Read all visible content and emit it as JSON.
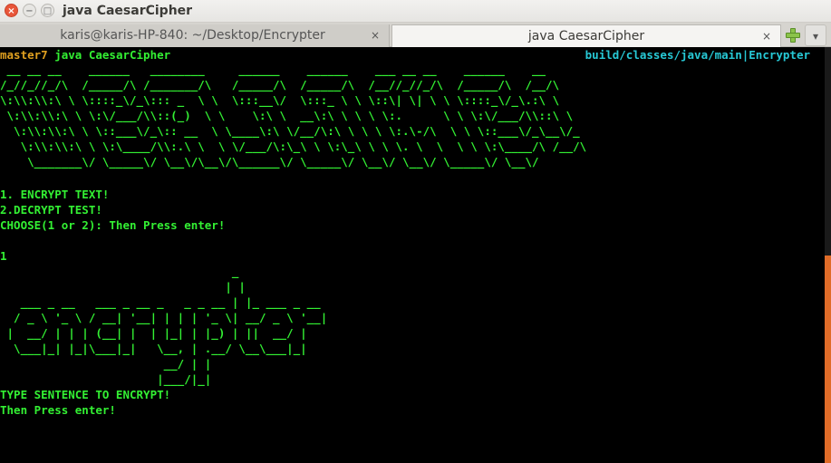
{
  "window": {
    "title": "java CaesarCipher",
    "close_glyph": "×",
    "min_glyph": "−",
    "max_glyph": "□"
  },
  "tabs": [
    {
      "label": "karis@karis-HP-840: ~/Desktop/Encrypter",
      "close": "×",
      "active": false
    },
    {
      "label": "java CaesarCipher",
      "close": "×",
      "active": true
    }
  ],
  "tab_menu_glyph": "▾",
  "terminal": {
    "prompt_branch": "master",
    "prompt_marker": "7",
    "prompt_command": " java CaesarCipher",
    "path_right": "build/classes/java/main|",
    "path_right_name": "Encrypter",
    "banner": [
      " __ __ __    ______   ________     ______    ______    ___ __ __    ______    __",
      "/_//_//_/\\  /_____/\\ /_______/\\   /_____/\\  /_____/\\  /__//_//_/\\  /_____/\\  /__/\\",
      "\\:\\\\:\\\\:\\ \\ \\::::_\\/_\\::: _  \\ \\  \\:::__\\/  \\:::_ \\ \\ \\::\\| \\| \\ \\ \\::::_\\/_\\.:\\ \\",
      " \\:\\\\:\\\\:\\ \\ \\:\\/___/\\\\::(_)  \\ \\    \\:\\ \\  __\\:\\ \\ \\ \\ \\:.      \\ \\ \\:\\/___/\\\\::\\ \\",
      "  \\:\\\\:\\\\:\\ \\ \\::___\\/_\\:: __  \\ \\____\\:\\ \\/__/\\:\\ \\ \\ \\ \\:.\\-/\\  \\ \\ \\::___\\/_\\__\\/_",
      "   \\:\\\\:\\\\:\\ \\ \\:\\____/\\\\:.\\ \\  \\ \\/___/\\:\\_\\ \\ \\:\\_\\ \\ \\ \\. \\  \\  \\ \\ \\:\\____/\\ /__/\\",
      "    \\_______\\/ \\_____\\/ \\__\\/\\__\\/\\______\\/ \\_____\\/ \\__\\/ \\__\\/ \\_____\\/ \\__\\/"
    ],
    "menu": [
      "1. ENCRYPT TEXT!",
      "2.DECRYPT TEST!",
      "CHOOSE(1 or 2): Then Press enter!"
    ],
    "user_input": "1",
    "figlet": [
      "                                  _",
      "                                 | |",
      "   ___ _ __   ___ _ __ _   _ _ __ | |_ ___ _ __",
      "  / _ \\ '_ \\ / __| '__| | | | '_ \\| __/ _ \\ '__|",
      " |  __/ | | | (__| |  | |_| | |_) | ||  __/ |",
      "  \\___|_| |_|\\___|_|   \\__, | .__/ \\__\\___|_|",
      "                        __/ | |",
      "                       |___/|_|"
    ],
    "instructions": [
      "TYPE SENTENCE TO ENCRYPT!",
      "Then Press enter!"
    ]
  },
  "colors": {
    "terminal_bg": "#000000",
    "terminal_text": "#33f033",
    "prompt_branch": "#e0a020",
    "path": "#27c9d6",
    "scroll_thumb": "#e06c28"
  }
}
